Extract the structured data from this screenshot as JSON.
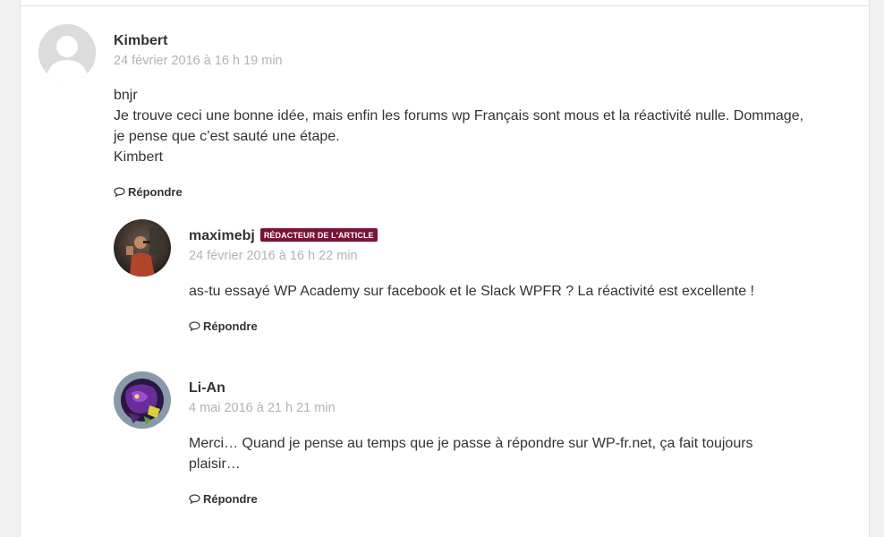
{
  "comments": [
    {
      "author": "Kimbert",
      "date": "24 février 2016 à 16 h 19 min",
      "text_lines": [
        "bnjr",
        "Je trouve ceci une bonne idée, mais enfin les forums wp Français sont mous et la réactivité nulle. Dommage,",
        "je pense que c’est sauté une étape.",
        "Kimbert"
      ],
      "reply_label": "Répondre",
      "avatar_icon": "default-person-avatar"
    },
    {
      "author": "maximebj",
      "badge": "RÉDACTEUR DE L'ARTICLE",
      "date": "24 février 2016 à 16 h 22 min",
      "text_lines": [
        "as-tu essayé WP Academy sur facebook et le Slack WPFR ? La réactivité est excellente !"
      ],
      "reply_label": "Répondre",
      "avatar_icon": "photo-avatar"
    },
    {
      "author": "Li-An",
      "date": "4 mai 2016 à 21 h 21 min",
      "text_lines": [
        "Merci… Quand je pense au temps que je passe à répondre sur WP-fr.net, ça fait toujours",
        "plaisir…"
      ],
      "reply_label": "Répondre",
      "avatar_icon": "illustrated-avatar"
    }
  ],
  "colors": {
    "badge_bg": "#7a1236",
    "date_text": "#b3b3b3",
    "body_text": "#333333"
  }
}
